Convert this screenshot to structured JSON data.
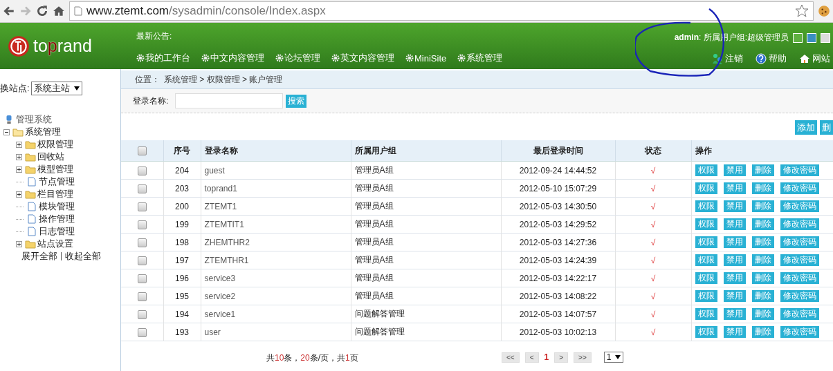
{
  "browser": {
    "url_host": "www.ztemt.com",
    "url_path": "/sysadmin/console/Index.aspx"
  },
  "header": {
    "logo": {
      "before": "to",
      "accent": "p",
      "after": "rand"
    },
    "notice_label": "最新公告:",
    "nav": [
      {
        "label": "我的工作台"
      },
      {
        "label": "中文内容管理"
      },
      {
        "label": "论坛管理"
      },
      {
        "label": "英文内容管理"
      },
      {
        "label": "MiniSite"
      },
      {
        "label": "系统管理"
      }
    ],
    "user": {
      "name": "admin",
      "info": ": 所属用户组:超级管理员"
    },
    "skins": [
      {
        "color": "#5fb040",
        "selected": false
      },
      {
        "color": "#3a8fc0",
        "selected": false
      },
      {
        "color": "#dcdcdc",
        "selected": false
      }
    ],
    "links": [
      {
        "kind": "logout",
        "label": "注销"
      },
      {
        "kind": "help",
        "label": "帮助"
      },
      {
        "kind": "home",
        "label": "网站"
      }
    ]
  },
  "sidebar": {
    "site_label": "换站点:",
    "site_value": "系统主站",
    "tree": [
      {
        "label": "管理系统",
        "children": [
          {
            "label": "系统管理",
            "kind": "folder",
            "expanded": true,
            "children": [
              {
                "label": "权限管理",
                "kind": "folder",
                "expanded": false
              },
              {
                "label": "回收站",
                "kind": "folder",
                "expanded": false
              },
              {
                "label": "模型管理",
                "kind": "folder",
                "expanded": false
              },
              {
                "label": "节点管理",
                "kind": "page"
              },
              {
                "label": "栏目管理",
                "kind": "folder",
                "expanded": false
              },
              {
                "label": "模块管理",
                "kind": "page"
              },
              {
                "label": "操作管理",
                "kind": "page"
              },
              {
                "label": "日志管理",
                "kind": "page"
              },
              {
                "label": "站点设置",
                "kind": "folder",
                "expanded": false
              }
            ]
          }
        ]
      }
    ],
    "expand_all": "展开全部",
    "collapse_all": "收起全部"
  },
  "breadcrumb": {
    "label": "位置：",
    "path": "系统管理 > 权限管理 > 账户管理"
  },
  "search": {
    "label": "登录名称:",
    "button": "搜索"
  },
  "toolbar": [
    "添加",
    "删"
  ],
  "table": {
    "select_all_checked": false,
    "columns": [
      "序号",
      "登录名称",
      "所属用户组",
      "最后登录时间",
      "状态",
      "操作"
    ],
    "rows": [
      {
        "checked": false,
        "id": "204",
        "name": "guest",
        "group": "管理员A组",
        "time": "2012-09-24 14:44:52",
        "status": "√",
        "actions": [
          "权限",
          "禁用",
          "删除",
          "修改密码"
        ]
      },
      {
        "checked": false,
        "id": "203",
        "name": "toprand1",
        "group": "管理员A组",
        "time": "2012-05-10 15:07:29",
        "status": "√",
        "actions": [
          "权限",
          "禁用",
          "删除",
          "修改密码"
        ]
      },
      {
        "checked": false,
        "id": "200",
        "name": "ZTEMT1",
        "group": "管理员A组",
        "time": "2012-05-03 14:30:50",
        "status": "√",
        "actions": [
          "权限",
          "禁用",
          "删除",
          "修改密码"
        ]
      },
      {
        "checked": false,
        "id": "199",
        "name": "ZTEMTIT1",
        "group": "管理员A组",
        "time": "2012-05-03 14:29:52",
        "status": "√",
        "actions": [
          "权限",
          "禁用",
          "删除",
          "修改密码"
        ]
      },
      {
        "checked": false,
        "id": "198",
        "name": "ZHEMTHR2",
        "group": "管理员A组",
        "time": "2012-05-03 14:27:36",
        "status": "√",
        "actions": [
          "权限",
          "禁用",
          "删除",
          "修改密码"
        ]
      },
      {
        "checked": false,
        "id": "197",
        "name": "ZTEMTHR1",
        "group": "管理员A组",
        "time": "2012-05-03 14:24:39",
        "status": "√",
        "actions": [
          "权限",
          "禁用",
          "删除",
          "修改密码"
        ]
      },
      {
        "checked": false,
        "id": "196",
        "name": "service3",
        "group": "管理员A组",
        "time": "2012-05-03 14:22:17",
        "status": "√",
        "actions": [
          "权限",
          "禁用",
          "删除",
          "修改密码"
        ]
      },
      {
        "checked": false,
        "id": "195",
        "name": "service2",
        "group": "管理员A组",
        "time": "2012-05-03 14:08:22",
        "status": "√",
        "actions": [
          "权限",
          "禁用",
          "删除",
          "修改密码"
        ]
      },
      {
        "checked": false,
        "id": "194",
        "name": "service1",
        "group": "问题解答管理",
        "time": "2012-05-03 14:07:57",
        "status": "√",
        "actions": [
          "权限",
          "禁用",
          "删除",
          "修改密码"
        ]
      },
      {
        "checked": false,
        "id": "193",
        "name": "user",
        "group": "问题解答管理",
        "time": "2012-05-03 10:02:13",
        "status": "√",
        "actions": [
          "权限",
          "禁用",
          "删除",
          "修改密码"
        ]
      }
    ]
  },
  "pager": {
    "summary": [
      {
        "kind": "plain",
        "text": "共"
      },
      {
        "kind": "num",
        "text": "10"
      },
      {
        "kind": "plain",
        "text": "条，"
      },
      {
        "kind": "num",
        "text": "20"
      },
      {
        "kind": "plain",
        "text": "条/页，共"
      },
      {
        "kind": "num",
        "text": "1"
      },
      {
        "kind": "plain",
        "text": "页"
      }
    ],
    "buttons": [
      {
        "kind": "nav",
        "label": "<<"
      },
      {
        "kind": "nav",
        "label": "<"
      },
      {
        "kind": "current",
        "label": "1"
      },
      {
        "kind": "nav",
        "label": ">"
      },
      {
        "kind": "nav",
        "label": ">>"
      }
    ],
    "page_select": "1"
  }
}
